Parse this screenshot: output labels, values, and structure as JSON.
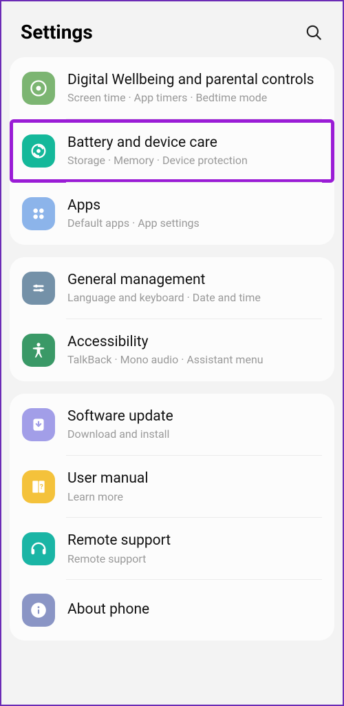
{
  "header": {
    "title": "Settings"
  },
  "groups": [
    {
      "items": [
        {
          "title": "Digital Wellbeing and parental controls",
          "sub": "Screen time  ·  App timers  ·  Bedtime mode"
        },
        {
          "title": "Battery and device care",
          "sub": "Storage  ·  Memory  ·  Device protection",
          "highlighted": true
        },
        {
          "title": "Apps",
          "sub": "Default apps  ·  App settings"
        }
      ]
    },
    {
      "items": [
        {
          "title": "General management",
          "sub": "Language and keyboard  ·  Date and time"
        },
        {
          "title": "Accessibility",
          "sub": "TalkBack  ·  Mono audio  ·  Assistant menu"
        }
      ]
    },
    {
      "items": [
        {
          "title": "Software update",
          "sub": "Download and install"
        },
        {
          "title": "User manual",
          "sub": "Learn more"
        },
        {
          "title": "Remote support",
          "sub": "Remote support"
        },
        {
          "title": "About phone",
          "sub": ""
        }
      ]
    }
  ]
}
